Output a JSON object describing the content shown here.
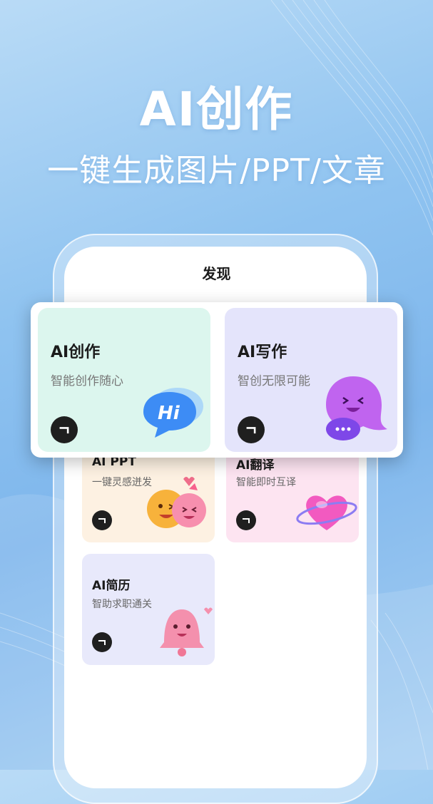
{
  "hero": {
    "title": "AI创作",
    "subtitle": "一键生成图片/PPT/文章"
  },
  "screen": {
    "title": "发现"
  },
  "featured": [
    {
      "title": "AI创作",
      "desc": "智能创作随心",
      "icon": "hi-chat-bubble-icon",
      "color": "#dcf6ee"
    },
    {
      "title": "AI写作",
      "desc": "智创无限可能",
      "icon": "purple-chat-bubble-icon",
      "color": "#e4e4fb"
    }
  ],
  "cards": [
    {
      "title": "AI PPT",
      "desc": "一键灵感迸发",
      "icon": "emoji-faces-icon",
      "color": "#fdf1e2"
    },
    {
      "title": "AI翻译",
      "desc": "智能即时互译",
      "icon": "heart-planet-icon",
      "color": "#fde4f1"
    },
    {
      "title": "AI简历",
      "desc": "智助求职通关",
      "icon": "pink-bell-icon",
      "color": "#e8e9fb"
    }
  ],
  "colors": {
    "background": "#8fc3f0",
    "text_dark": "#1b1b1b",
    "button_dark": "#1f1f1f"
  }
}
